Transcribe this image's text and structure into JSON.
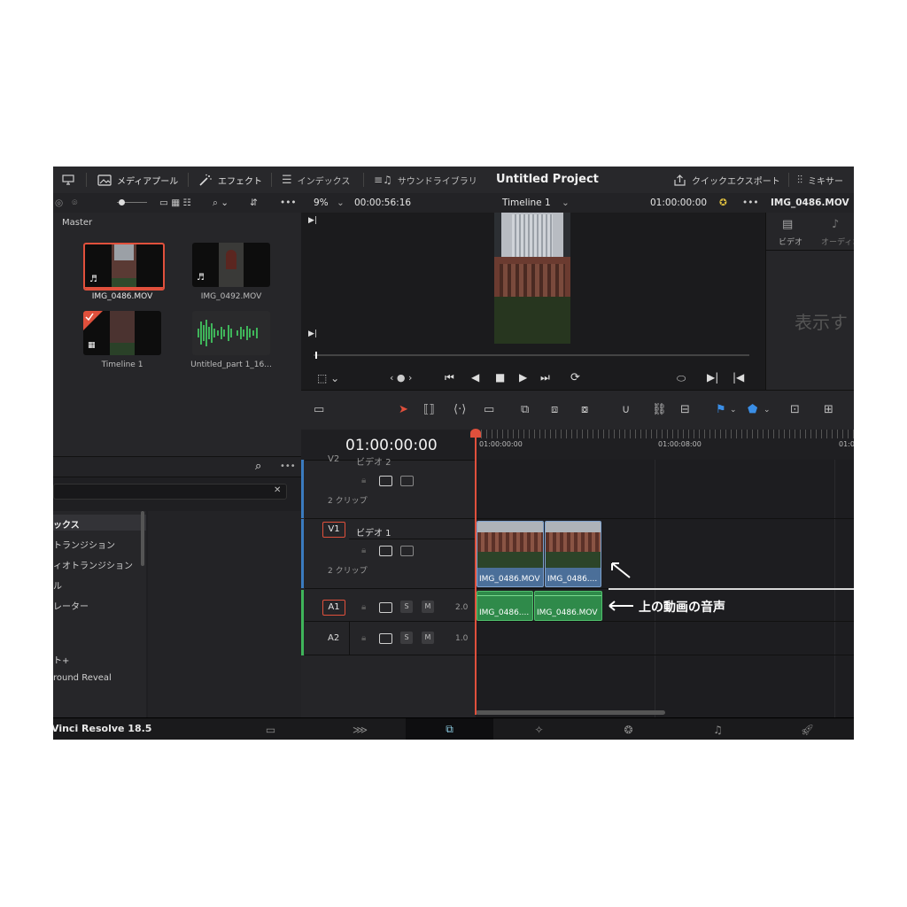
{
  "toolbar": {
    "media_pool": "メディアプール",
    "effects": "エフェクト",
    "index": "インデックス",
    "sound_library": "サウンドライブラリ",
    "project_title": "Untitled Project",
    "quick_export": "クイックエクスポート",
    "mixer": "ミキサー"
  },
  "viewer_bar": {
    "zoom": "9%",
    "duration": "00:00:56:16",
    "timeline_name": "Timeline 1",
    "timecode": "01:00:00:00",
    "clip_name": "IMG_0486.MOV"
  },
  "inspector": {
    "tab_video": "ビデオ",
    "tab_audio": "オーディオ",
    "empty_text": "表示す"
  },
  "media_pool": {
    "folder": "Master",
    "items": [
      {
        "name": "IMG_0486.MOV"
      },
      {
        "name": "IMG_0492.MOV"
      },
      {
        "name": "Timeline 1"
      },
      {
        "name": "Untitled_part 1_16..."
      }
    ]
  },
  "effects": {
    "list": [
      "ックス",
      "トランジション",
      "ィオトランジション",
      "ル",
      "レーター"
    ],
    "items": [
      "ト+",
      "round Reveal"
    ]
  },
  "timeline": {
    "timecode": "01:00:00:00",
    "ruler": [
      "01:00:00:00",
      "01:00:08:00",
      "01:0"
    ],
    "tracks": {
      "v2": {
        "id": "V2",
        "name": "ビデオ 2",
        "clips": "2 クリップ"
      },
      "v1": {
        "id": "V1",
        "name": "ビデオ 1",
        "clips": "2 クリップ"
      },
      "a1": {
        "id": "A1",
        "level": "2.0"
      },
      "a2": {
        "id": "A2",
        "level": "1.0"
      }
    },
    "video_clips": [
      "IMG_0486.MOV",
      "IMG_0486...."
    ],
    "audio_clips": [
      "IMG_0486....",
      "IMG_0486.MOV"
    ],
    "solo": "S",
    "mute": "M"
  },
  "annotation": {
    "text": "上の動画の音声"
  },
  "footer": {
    "version": "Vinci Resolve 18.5"
  }
}
